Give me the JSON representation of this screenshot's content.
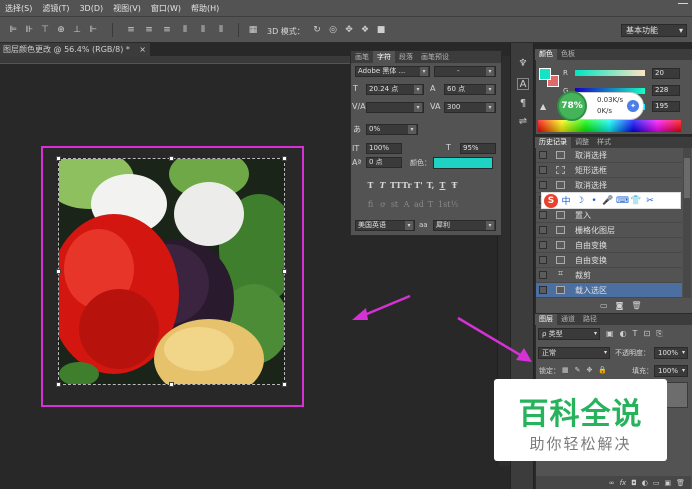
{
  "menu": [
    "选择(S)",
    "滤镜(T)",
    "3D(D)",
    "视图(V)",
    "窗口(W)",
    "帮助(H)"
  ],
  "options_bar": {
    "mode_label": "3D 模式：",
    "workspace": "基本功能"
  },
  "document": {
    "tab_title": "图层颜色更改 @ 56.4% (RGB/8) *",
    "close": "×"
  },
  "character_panel": {
    "tabs": [
      "画笔",
      "字符",
      "段落",
      "画笔预设"
    ],
    "active_tab": "字符",
    "font_family": "Adobe 黑体 ...",
    "font_style": "-",
    "size": "20.24 点",
    "leading": "60 点",
    "kerning": "",
    "tracking": "300",
    "tsume": "0%",
    "vertical_scale": "100%",
    "horizontal_scale": "95%",
    "baseline_shift": "0 点",
    "color_label": "颜色：",
    "color": "#1fd3c4",
    "style_glyphs": [
      "T",
      "T",
      "TT",
      "Tr",
      "T'",
      "T,",
      "T",
      "Ŧ"
    ],
    "opentype_glyphs": [
      "fi",
      "ơ",
      "st",
      "A",
      "ad",
      "T",
      "1st",
      "½"
    ],
    "language": "美国英语",
    "aa_label": "aa",
    "antialias": "犀利"
  },
  "color_panel": {
    "tabs": [
      "颜色",
      "色板"
    ],
    "r_label": "R",
    "g_label": "G",
    "b_label": "B",
    "r": "20",
    "g": "228",
    "b": "195",
    "foreground": "#14e4c3",
    "background": "#e06a6a"
  },
  "speed_widget": {
    "percent": "78%",
    "up": "0.03K/s",
    "down": "0K/s"
  },
  "history_panel": {
    "tabs": [
      "历史记录",
      "调整",
      "样式"
    ],
    "items": [
      {
        "label": "取消选择",
        "icon": "square-icon",
        "selected": false
      },
      {
        "label": "矩形选框",
        "icon": "marquee-icon",
        "selected": false
      },
      {
        "label": "取消选择",
        "icon": "square-icon",
        "selected": false
      },
      {
        "label": "",
        "icon": "",
        "selected": false
      },
      {
        "label": "置入",
        "icon": "square-icon",
        "selected": false
      },
      {
        "label": "栅格化图层",
        "icon": "square-icon",
        "selected": false
      },
      {
        "label": "自由变换",
        "icon": "square-icon",
        "selected": false
      },
      {
        "label": "自由变换",
        "icon": "square-icon",
        "selected": false
      },
      {
        "label": "裁剪",
        "icon": "crop-icon",
        "selected": false
      },
      {
        "label": "载入选区",
        "icon": "square-icon",
        "selected": true
      }
    ]
  },
  "ime_bar": {
    "logo": "S",
    "items": [
      "中",
      "☽",
      "•",
      "🎤",
      "⌨",
      "👕",
      "✂"
    ]
  },
  "layers_panel": {
    "tabs": [
      "图层",
      "通道",
      "路径"
    ],
    "filter": "ρ 类型",
    "blend_mode": "正常",
    "opacity_label": "不透明度：",
    "opacity": "100%",
    "lock_label": "锁定：",
    "fill_label": "填充：",
    "fill": "100%",
    "bottom_icons": [
      "∞",
      "fx",
      "◘",
      "◐",
      "▭",
      "▣",
      "🗑"
    ]
  },
  "watermark": {
    "title": "百科全说",
    "subtitle": "助你轻松解决"
  }
}
